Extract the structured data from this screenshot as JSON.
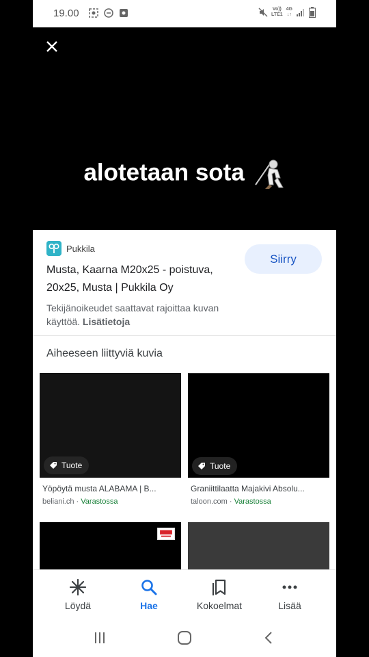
{
  "status_bar": {
    "time": "19.00",
    "network_top": "Vo))",
    "network_bottom": "LTE1",
    "signal_label": "4G"
  },
  "media": {
    "caption": "alotetaan sota"
  },
  "info": {
    "source_name": "Pukkila",
    "title": "Musta, Kaarna M20x25 - poistuva, 20x25, Musta | Pukkila Oy",
    "visit_label": "Siirry",
    "copyright_text": "Tekijänoikeudet saattavat rajoittaa kuvan käyttöä.",
    "copyright_link": "Lisätietoja"
  },
  "related": {
    "heading": "Aiheeseen liittyviä kuvia",
    "results": [
      {
        "badge": "Tuote",
        "title": "Yöpöytä musta ALABAMA | B...",
        "domain": "beliani.ch",
        "stock": "Varastossa"
      },
      {
        "badge": "Tuote",
        "title": "Graniittilaatta Majakivi Absolu...",
        "domain": "taloon.com",
        "stock": "Varastossa"
      }
    ]
  },
  "bottom_nav": {
    "items": [
      {
        "label": "Löydä",
        "icon": "discover-asterisk-icon"
      },
      {
        "label": "Hae",
        "icon": "search-icon",
        "active": true
      },
      {
        "label": "Kokoelmat",
        "icon": "collections-bookmark-icon"
      },
      {
        "label": "Lisää",
        "icon": "more-dots-icon"
      }
    ]
  },
  "colors": {
    "accent": "#1a73e8",
    "visit_button_bg": "#e8f0fe",
    "stock_green": "#188038",
    "source_logo": "#2fb3c7"
  }
}
